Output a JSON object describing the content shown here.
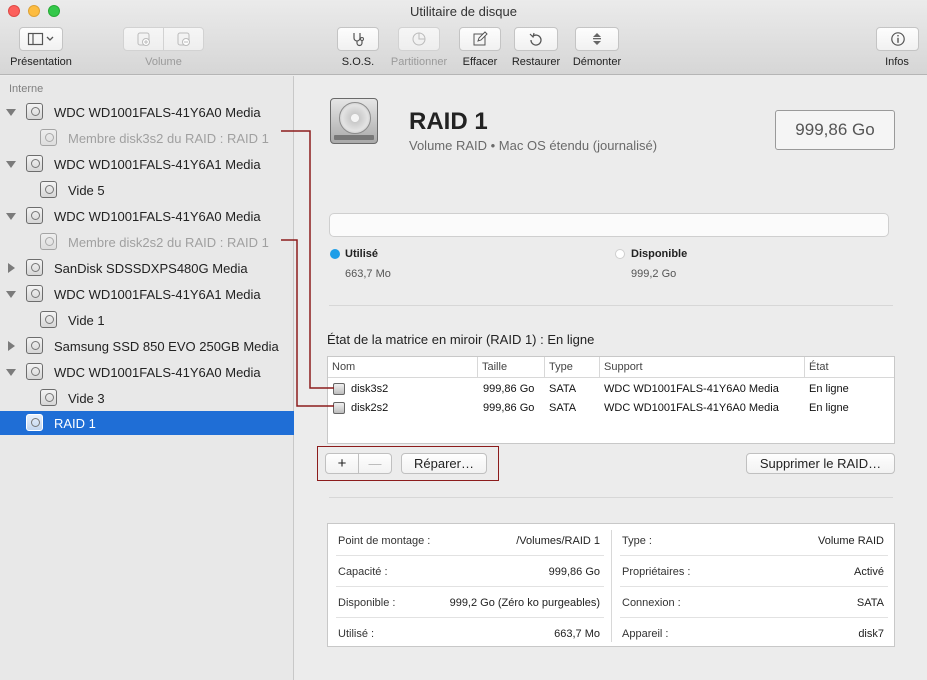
{
  "window": {
    "title": "Utilitaire de disque"
  },
  "toolbar": {
    "presentation": "Présentation",
    "volume": "Volume",
    "sos": "S.O.S.",
    "partition": "Partitionner",
    "erase": "Effacer",
    "restore": "Restaurer",
    "unmount": "Démonter",
    "info": "Infos"
  },
  "sidebar": {
    "section": "Interne",
    "items": [
      {
        "label": "WDC WD1001FALS-41Y6A0 Media"
      },
      {
        "label": "Membre disk3s2 du RAID : RAID 1"
      },
      {
        "label": "WDC WD1001FALS-41Y6A1 Media"
      },
      {
        "label": "Vide 5"
      },
      {
        "label": "WDC WD1001FALS-41Y6A0 Media"
      },
      {
        "label": "Membre disk2s2 du RAID : RAID 1"
      },
      {
        "label": "SanDisk SDSSDXPS480G Media"
      },
      {
        "label": "WDC WD1001FALS-41Y6A1 Media"
      },
      {
        "label": "Vide 1"
      },
      {
        "label": "Samsung SSD 850 EVO 250GB Media"
      },
      {
        "label": "WDC WD1001FALS-41Y6A0 Media"
      },
      {
        "label": "Vide 3"
      },
      {
        "label": "RAID 1"
      }
    ]
  },
  "volume": {
    "name": "RAID 1",
    "subtitle": "Volume RAID • Mac OS étendu (journalisé)",
    "size": "999,86 Go"
  },
  "usage": {
    "used_label": "Utilisé",
    "used_value": "663,7 Mo",
    "used_color": "#1e9ee8",
    "free_label": "Disponible",
    "free_value": "999,2 Go"
  },
  "mirror": {
    "title": "État de la matrice en miroir (RAID 1) : En ligne",
    "columns": {
      "name": "Nom",
      "size": "Taille",
      "type": "Type",
      "support": "Support",
      "state": "État"
    },
    "rows": [
      {
        "name": "disk3s2",
        "size": "999,86 Go",
        "type": "SATA",
        "support": "WDC WD1001FALS-41Y6A0 Media",
        "state": "En ligne"
      },
      {
        "name": "disk2s2",
        "size": "999,86 Go",
        "type": "SATA",
        "support": "WDC WD1001FALS-41Y6A0 Media",
        "state": "En ligne"
      }
    ],
    "add": "+",
    "remove": "—",
    "repair": "Réparer…",
    "delete": "Supprimer le RAID…"
  },
  "info": {
    "left": [
      {
        "key": "Point de montage :",
        "value": "/Volumes/RAID 1"
      },
      {
        "key": "Capacité :",
        "value": "999,86 Go"
      },
      {
        "key": "Disponible :",
        "value": "999,2 Go (Zéro ko purgeables)"
      },
      {
        "key": "Utilisé :",
        "value": "663,7 Mo"
      }
    ],
    "right": [
      {
        "key": "Type :",
        "value": "Volume RAID"
      },
      {
        "key": "Propriétaires :",
        "value": "Activé"
      },
      {
        "key": "Connexion :",
        "value": "SATA"
      },
      {
        "key": "Appareil :",
        "value": "disk7"
      }
    ]
  },
  "annotation_color": "#8c1c1c"
}
